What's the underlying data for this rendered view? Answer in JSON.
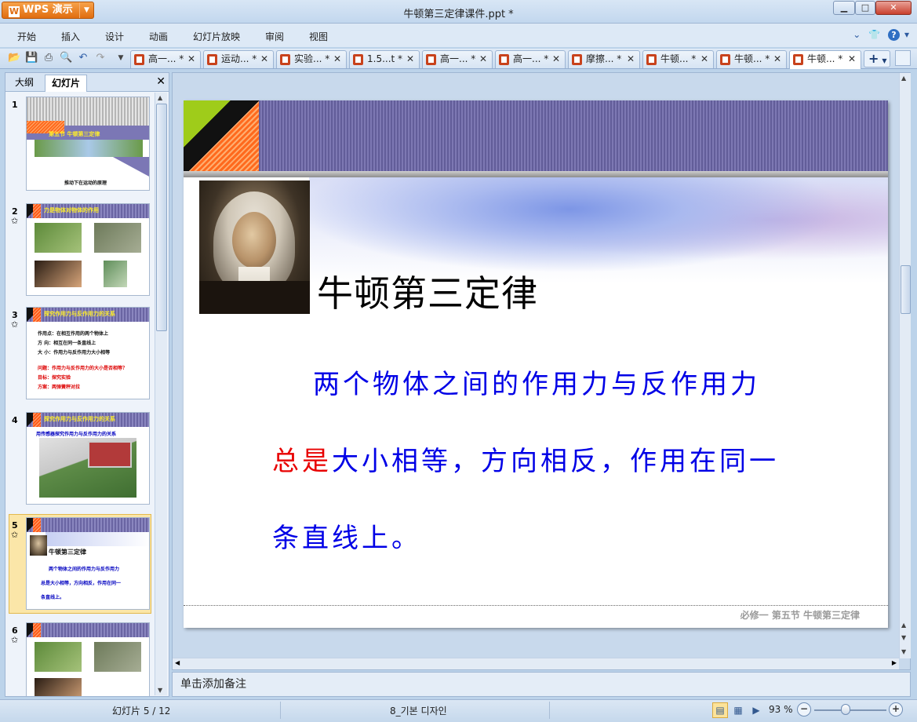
{
  "app": {
    "name": "WPS 演示",
    "title": "牛顿第三定律课件.ppt *"
  },
  "menu": [
    "开始",
    "插入",
    "设计",
    "动画",
    "幻灯片放映",
    "审阅",
    "视图"
  ],
  "tabs": [
    {
      "label": "高一... *"
    },
    {
      "label": "运动... *"
    },
    {
      "label": "实验... *"
    },
    {
      "label": "1.5...t *"
    },
    {
      "label": "高一... *"
    },
    {
      "label": "高一... *"
    },
    {
      "label": "摩擦... *"
    },
    {
      "label": "牛顿... *"
    },
    {
      "label": "牛顿... *"
    },
    {
      "label": "牛顿... *"
    }
  ],
  "panel": {
    "tab_outline": "大纲",
    "tab_slides": "幻灯片"
  },
  "thumbnails": [
    {
      "num": "1",
      "title": "第五节  牛顿第三定律",
      "caption": "推动下在运动的原理"
    },
    {
      "num": "2",
      "title": "力是物体对物体的作用"
    },
    {
      "num": "3",
      "title": "探究作用力与反作用力的关系",
      "lines": [
        "作用点：在相互作用的两个物体上",
        "方  向：相互在同一条直线上",
        "大  小：作用力与反作用力大小相等",
        "问题：作用力与反作用力的大小是否相等？",
        "目标：探究实验",
        "方案：两弹簧秤对拉"
      ]
    },
    {
      "num": "4",
      "title": "探究作用力与反作用力的关系",
      "subtitle": "用传感器探究作用力与反作用力的关系"
    },
    {
      "num": "5",
      "title": "牛顿第三定律",
      "lines": [
        "两个物体之间的作用力与反作用力",
        "总是大小相等，方向相反，作用在同一",
        "条直线上。"
      ]
    },
    {
      "num": "6"
    }
  ],
  "slide": {
    "title": "牛顿第三定律",
    "line1": "两个物体之间的作用力与反作用力",
    "line2_red": "总是",
    "line2_rest": "大小相等，方向相反，作用在同一",
    "line3": "条直线上。",
    "footer": "必修一   第五节   牛顿第三定律"
  },
  "notes_placeholder": "单击添加备注",
  "status": {
    "slides": "幻灯片 5 / 12",
    "theme": "8_기본 디자인",
    "zoom": "93 %"
  },
  "colors": {
    "accent": "#e06d10",
    "slide_text": "#0000e6",
    "slide_red": "#e80000",
    "header_purple": "#6a65a3"
  }
}
